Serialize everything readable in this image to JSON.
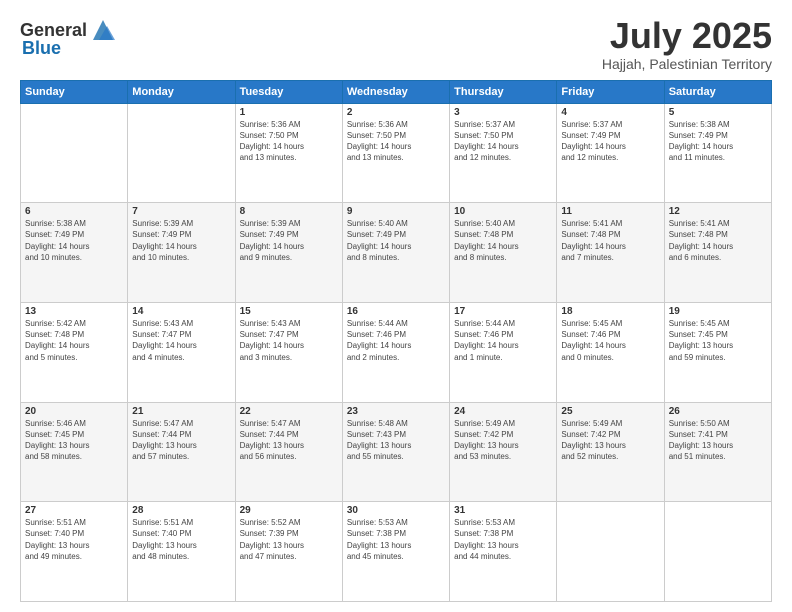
{
  "logo": {
    "general": "General",
    "blue": "Blue"
  },
  "header": {
    "month_year": "July 2025",
    "location": "Hajjah, Palestinian Territory"
  },
  "days_of_week": [
    "Sunday",
    "Monday",
    "Tuesday",
    "Wednesday",
    "Thursday",
    "Friday",
    "Saturday"
  ],
  "weeks": [
    [
      {
        "day": "",
        "info": ""
      },
      {
        "day": "",
        "info": ""
      },
      {
        "day": "1",
        "info": "Sunrise: 5:36 AM\nSunset: 7:50 PM\nDaylight: 14 hours\nand 13 minutes."
      },
      {
        "day": "2",
        "info": "Sunrise: 5:36 AM\nSunset: 7:50 PM\nDaylight: 14 hours\nand 13 minutes."
      },
      {
        "day": "3",
        "info": "Sunrise: 5:37 AM\nSunset: 7:50 PM\nDaylight: 14 hours\nand 12 minutes."
      },
      {
        "day": "4",
        "info": "Sunrise: 5:37 AM\nSunset: 7:49 PM\nDaylight: 14 hours\nand 12 minutes."
      },
      {
        "day": "5",
        "info": "Sunrise: 5:38 AM\nSunset: 7:49 PM\nDaylight: 14 hours\nand 11 minutes."
      }
    ],
    [
      {
        "day": "6",
        "info": "Sunrise: 5:38 AM\nSunset: 7:49 PM\nDaylight: 14 hours\nand 10 minutes."
      },
      {
        "day": "7",
        "info": "Sunrise: 5:39 AM\nSunset: 7:49 PM\nDaylight: 14 hours\nand 10 minutes."
      },
      {
        "day": "8",
        "info": "Sunrise: 5:39 AM\nSunset: 7:49 PM\nDaylight: 14 hours\nand 9 minutes."
      },
      {
        "day": "9",
        "info": "Sunrise: 5:40 AM\nSunset: 7:49 PM\nDaylight: 14 hours\nand 8 minutes."
      },
      {
        "day": "10",
        "info": "Sunrise: 5:40 AM\nSunset: 7:48 PM\nDaylight: 14 hours\nand 8 minutes."
      },
      {
        "day": "11",
        "info": "Sunrise: 5:41 AM\nSunset: 7:48 PM\nDaylight: 14 hours\nand 7 minutes."
      },
      {
        "day": "12",
        "info": "Sunrise: 5:41 AM\nSunset: 7:48 PM\nDaylight: 14 hours\nand 6 minutes."
      }
    ],
    [
      {
        "day": "13",
        "info": "Sunrise: 5:42 AM\nSunset: 7:48 PM\nDaylight: 14 hours\nand 5 minutes."
      },
      {
        "day": "14",
        "info": "Sunrise: 5:43 AM\nSunset: 7:47 PM\nDaylight: 14 hours\nand 4 minutes."
      },
      {
        "day": "15",
        "info": "Sunrise: 5:43 AM\nSunset: 7:47 PM\nDaylight: 14 hours\nand 3 minutes."
      },
      {
        "day": "16",
        "info": "Sunrise: 5:44 AM\nSunset: 7:46 PM\nDaylight: 14 hours\nand 2 minutes."
      },
      {
        "day": "17",
        "info": "Sunrise: 5:44 AM\nSunset: 7:46 PM\nDaylight: 14 hours\nand 1 minute."
      },
      {
        "day": "18",
        "info": "Sunrise: 5:45 AM\nSunset: 7:46 PM\nDaylight: 14 hours\nand 0 minutes."
      },
      {
        "day": "19",
        "info": "Sunrise: 5:45 AM\nSunset: 7:45 PM\nDaylight: 13 hours\nand 59 minutes."
      }
    ],
    [
      {
        "day": "20",
        "info": "Sunrise: 5:46 AM\nSunset: 7:45 PM\nDaylight: 13 hours\nand 58 minutes."
      },
      {
        "day": "21",
        "info": "Sunrise: 5:47 AM\nSunset: 7:44 PM\nDaylight: 13 hours\nand 57 minutes."
      },
      {
        "day": "22",
        "info": "Sunrise: 5:47 AM\nSunset: 7:44 PM\nDaylight: 13 hours\nand 56 minutes."
      },
      {
        "day": "23",
        "info": "Sunrise: 5:48 AM\nSunset: 7:43 PM\nDaylight: 13 hours\nand 55 minutes."
      },
      {
        "day": "24",
        "info": "Sunrise: 5:49 AM\nSunset: 7:42 PM\nDaylight: 13 hours\nand 53 minutes."
      },
      {
        "day": "25",
        "info": "Sunrise: 5:49 AM\nSunset: 7:42 PM\nDaylight: 13 hours\nand 52 minutes."
      },
      {
        "day": "26",
        "info": "Sunrise: 5:50 AM\nSunset: 7:41 PM\nDaylight: 13 hours\nand 51 minutes."
      }
    ],
    [
      {
        "day": "27",
        "info": "Sunrise: 5:51 AM\nSunset: 7:40 PM\nDaylight: 13 hours\nand 49 minutes."
      },
      {
        "day": "28",
        "info": "Sunrise: 5:51 AM\nSunset: 7:40 PM\nDaylight: 13 hours\nand 48 minutes."
      },
      {
        "day": "29",
        "info": "Sunrise: 5:52 AM\nSunset: 7:39 PM\nDaylight: 13 hours\nand 47 minutes."
      },
      {
        "day": "30",
        "info": "Sunrise: 5:53 AM\nSunset: 7:38 PM\nDaylight: 13 hours\nand 45 minutes."
      },
      {
        "day": "31",
        "info": "Sunrise: 5:53 AM\nSunset: 7:38 PM\nDaylight: 13 hours\nand 44 minutes."
      },
      {
        "day": "",
        "info": ""
      },
      {
        "day": "",
        "info": ""
      }
    ]
  ]
}
